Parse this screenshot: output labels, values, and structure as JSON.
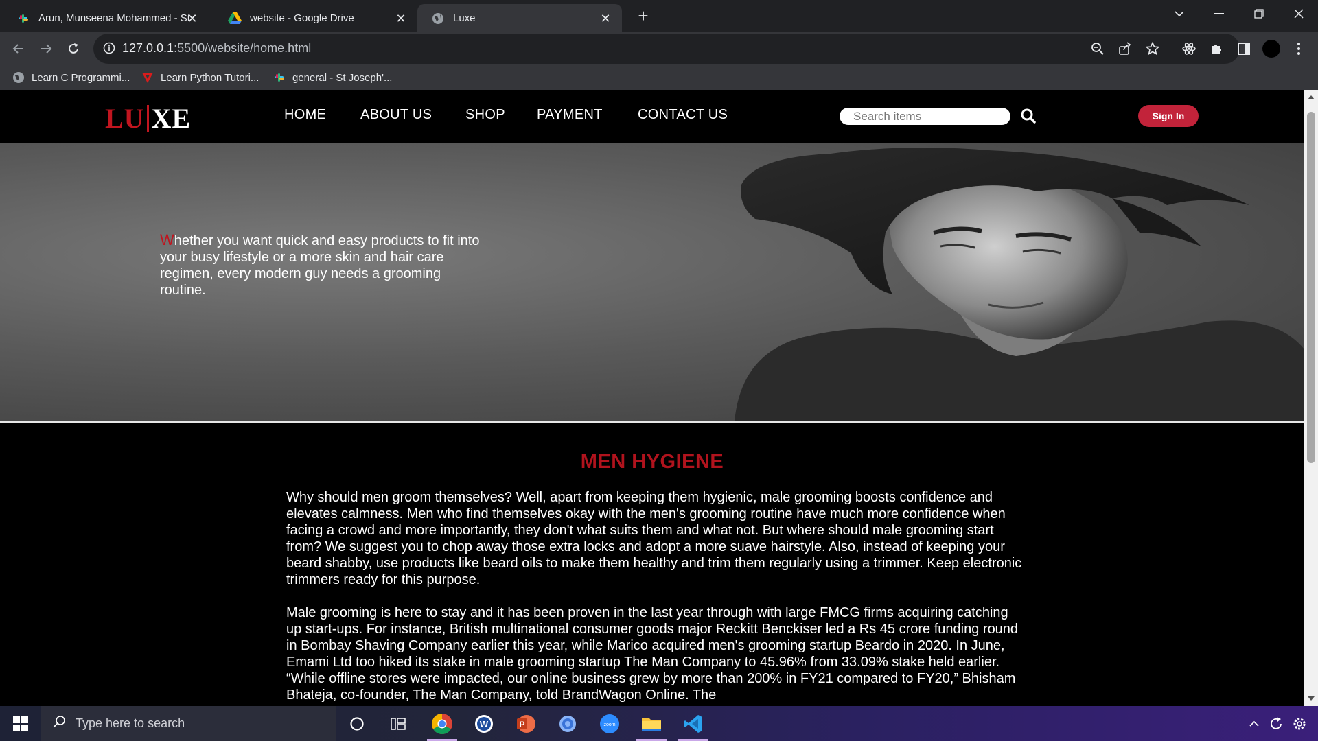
{
  "browser": {
    "tabs": [
      {
        "title": "Arun, Munseena Mohammed - St",
        "icon": "slack-icon",
        "active": false
      },
      {
        "title": "website - Google Drive",
        "icon": "google-drive-icon",
        "active": false
      },
      {
        "title": "Luxe",
        "icon": "globe-icon",
        "active": true
      }
    ],
    "url": {
      "host": "127.0.0.1",
      "path": ":5500/website/home.html"
    },
    "bookmarks": [
      {
        "label": "Learn C Programmi...",
        "icon": "globe-icon"
      },
      {
        "label": "Learn Python Tutori...",
        "icon": "tutorial-icon"
      },
      {
        "label": "general - St Joseph'...",
        "icon": "slack-icon"
      }
    ]
  },
  "site": {
    "logo": {
      "left": "LU",
      "right": "XE"
    },
    "nav": [
      "HOME",
      "ABOUT US",
      "SHOP",
      "PAYMENT",
      "CONTACT US"
    ],
    "search_placeholder": "Search items",
    "signin_label": "Sign In",
    "hero": {
      "first_letter": "W",
      "text": "hether you want quick and easy products to fit into your busy lifestyle or a more skin and hair care regimen, every modern guy needs a grooming routine."
    },
    "heading": "MEN HYGIENE",
    "paragraphs": [
      "Why should men groom themselves? Well, apart from keeping them hygienic, male grooming boosts confidence and elevates calmness. Men who find themselves okay with the men's grooming routine have much more confidence when facing a crowd and more importantly, they don't what suits them and what not. But where should male grooming start from? We suggest you to chop away those extra locks and adopt a more suave hairstyle. Also, instead of keeping your beard shabby, use products like beard oils to make them healthy and trim them regularly using a trimmer. Keep electronic trimmers ready for this purpose.",
      "Male grooming is here to stay and it has been proven in the last year through with large FMCG firms acquiring catching up start-ups. For instance, British multinational consumer goods major Reckitt Benckiser led a Rs 45 crore funding round in Bombay Shaving Company earlier this year, while Marico acquired men's grooming startup Beardo in 2020. In June, Emami Ltd too hiked its stake in male grooming startup The Man Company to 45.96% from 33.09% stake held earlier. “While offline stores were impacted, our online business grew by more than 200% in FY21 compared to FY20,” Bhisham Bhateja, co-founder, The Man Company, told BrandWagon Online. The"
    ],
    "colors": {
      "accent": "#c0151f",
      "heading": "#b0131d",
      "signin": "#c2233a"
    }
  },
  "taskbar": {
    "search_placeholder": "Type here to search",
    "apps": [
      "cortana-icon",
      "task-view-icon",
      "chrome-icon",
      "word-icon",
      "powerpoint-icon",
      "settings-icon",
      "zoom-icon",
      "file-explorer-icon",
      "vscode-icon"
    ]
  }
}
